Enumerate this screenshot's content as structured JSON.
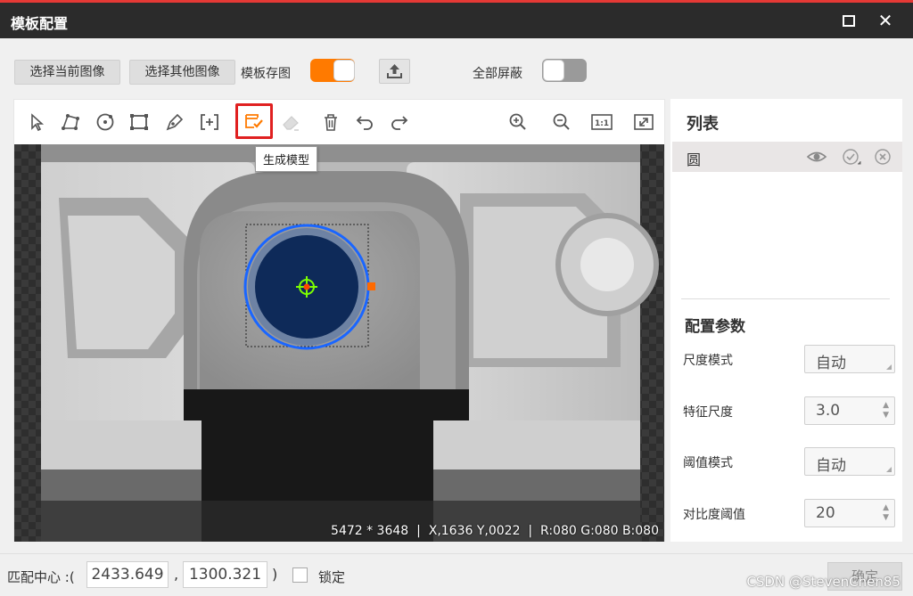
{
  "window": {
    "title": "模板配置"
  },
  "top_controls": {
    "select_current_image": "选择当前图像",
    "select_other_image": "选择其他图像",
    "template_save_image_label": "模板存图",
    "template_save_image_on": true,
    "mask_all_label": "全部屏蔽",
    "mask_all_on": false
  },
  "toolbar": {
    "tools": [
      "select-arrow-icon",
      "polygon-icon",
      "circle-icon",
      "rectangle-icon",
      "pen-icon",
      "add-region-icon",
      "generate-model-icon",
      "eraser-icon",
      "delete-icon",
      "undo-icon",
      "redo-icon",
      "zoom-in-icon",
      "zoom-out-icon",
      "actual-size-icon",
      "fit-window-icon"
    ],
    "actual_size_label": "1:1",
    "active_tool": "generate-model-icon",
    "tooltip": "生成模型"
  },
  "image_status": {
    "resolution": "5472 * 3648",
    "position": "X,1636  Y,0022",
    "rgb": "R:080  G:080  B:080"
  },
  "right_panel": {
    "list_title": "列表",
    "list_items": [
      {
        "name": "圆"
      }
    ],
    "params_title": "配置参数",
    "params": [
      {
        "label": "尺度模式",
        "value": "自动",
        "kind": "select"
      },
      {
        "label": "特征尺度",
        "value": "3.0",
        "kind": "spin"
      },
      {
        "label": "阈值模式",
        "value": "自动",
        "kind": "select"
      },
      {
        "label": "对比度阈值",
        "value": "20",
        "kind": "spin"
      }
    ]
  },
  "bottom": {
    "match_center_label": "匹配中心 :(",
    "center_x": "2433.649",
    "comma": ",",
    "center_y": "1300.321",
    "close_paren": ")",
    "lock_label": "锁定",
    "lock_checked": false,
    "ok_label": "确定",
    "watermark": "CSDN @StevenChen85"
  },
  "colors": {
    "accent_orange": "#ff7a00",
    "titlebar": "#2b2b2b",
    "highlight_red": "#e02020",
    "circle_blue": "#1a66ff",
    "crosshair_green": "#7cff00"
  }
}
